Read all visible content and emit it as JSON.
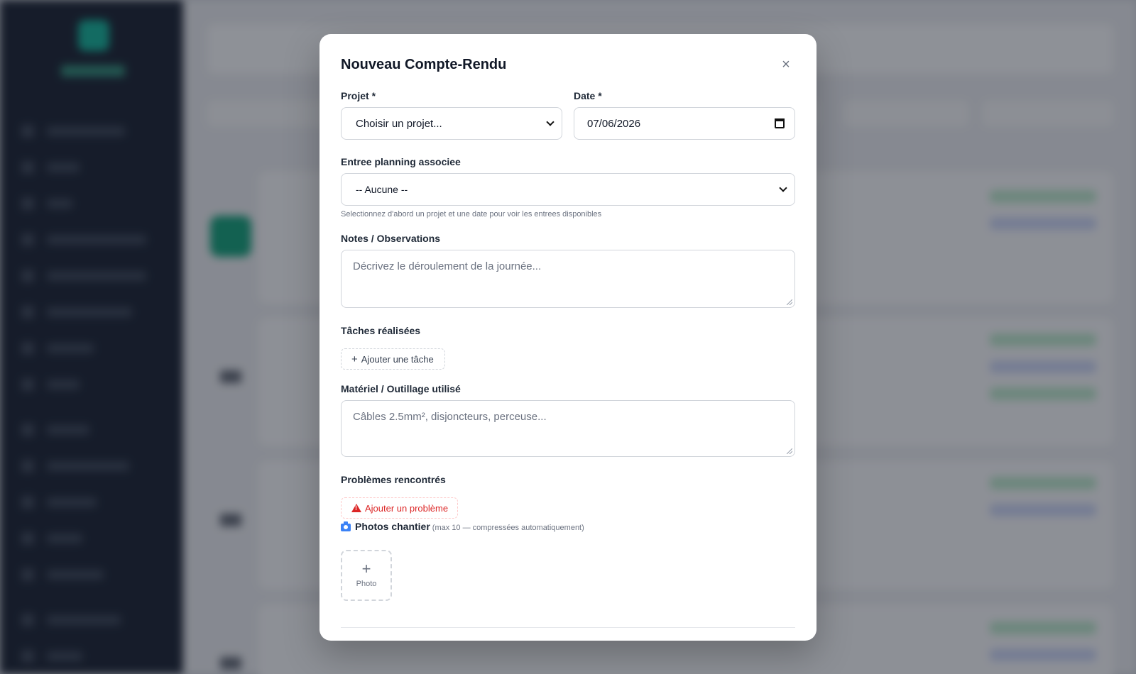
{
  "modal": {
    "title": "Nouveau Compte-Rendu",
    "close_icon": "×",
    "projet_label": "Projet *",
    "projet_value": "Choisir un projet...",
    "date_label": "Date *",
    "date_value": "07/06/2026",
    "planning_label": "Entree planning associee",
    "planning_value": "-- Aucune --",
    "planning_helper": "Selectionnez d'abord un projet et une date pour voir les entrees disponibles",
    "notes_label": "Notes / Observations",
    "notes_placeholder": "Décrivez le déroulement de la journée...",
    "taches_label": "Tâches réalisées",
    "add_task_label": "Ajouter une tâche",
    "materiel_label": "Matériel / Outillage utilisé",
    "materiel_placeholder": "Câbles 2.5mm², disjoncteurs, perceuse...",
    "problemes_label": "Problèmes rencontrés",
    "add_problem_label": "Ajouter un problème",
    "photos_label": "Photos chantier",
    "photos_note": "(max 10 — compressées automatiquement)",
    "photo_plus": "+",
    "photo_button_label": "Photo"
  },
  "colors": {
    "primary_text": "#111827",
    "danger": "#dc2626",
    "accent": "#3b82f6"
  }
}
